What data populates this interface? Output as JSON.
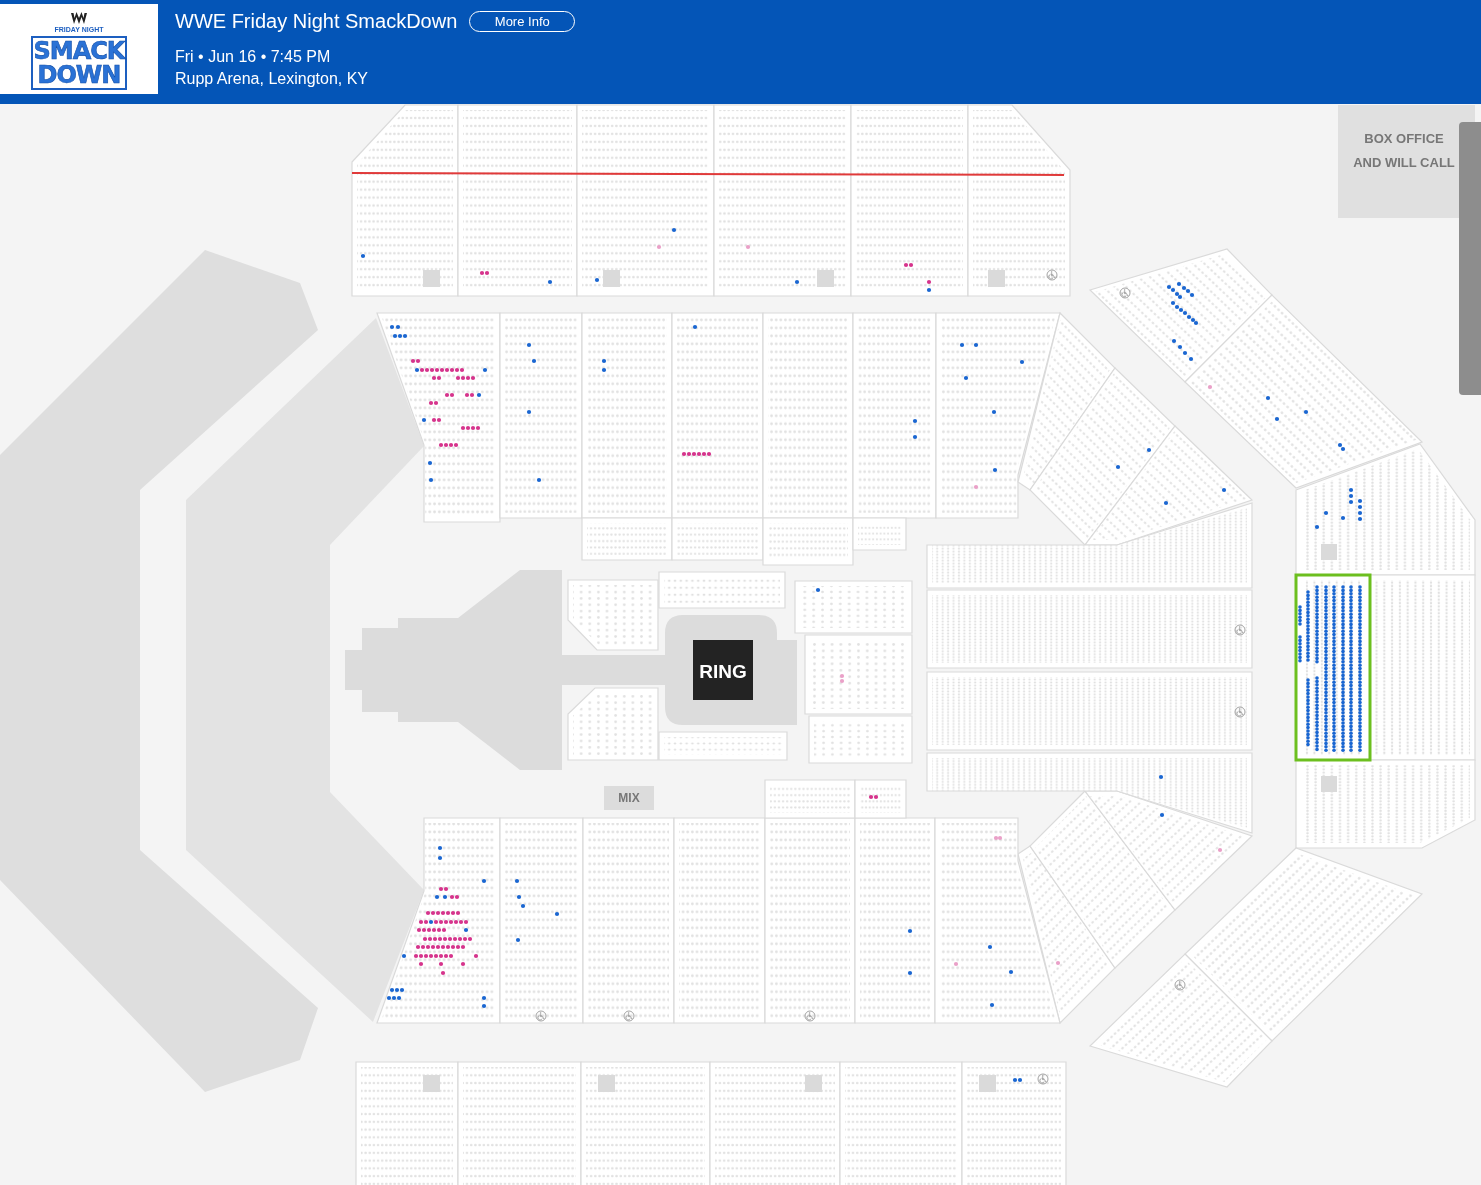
{
  "header": {
    "logo": {
      "wordmark_top": "FRIDAY NIGHT",
      "wordmark_lines": [
        "SMACK",
        "DOWN"
      ]
    },
    "event": {
      "title": "WWE Friday Night SmackDown",
      "button": "More Info",
      "date": "Fri • Jun 16 • 7:45 PM",
      "venue": "Rupp Arena, Lexington, KY"
    }
  },
  "seat_map": {
    "labels": {
      "box_office": [
        "BOX OFFICE",
        "AND WILL CALL"
      ],
      "ring": "RING",
      "mix": "MIX"
    },
    "seat_colors": [
      {
        "color": "#1a66d1"
      },
      {
        "color": "#d6338c"
      },
      {
        "color": "#eaa0c8"
      }
    ],
    "sections": [
      {
        "selected": false
      },
      {
        "selected": false
      },
      {
        "selected": false
      },
      {
        "selected": false
      },
      {
        "selected": false
      },
      {
        "selected": false
      },
      {
        "selected": false
      },
      {
        "selected": false
      },
      {
        "selected": false
      },
      {
        "selected": false
      },
      {
        "selected": false
      },
      {
        "selected": false
      },
      {
        "selected": false
      },
      {
        "selected": false
      },
      {
        "selected": false
      },
      {
        "selected": false
      },
      {
        "selected": false
      },
      {
        "selected": false
      },
      {
        "selected": false
      },
      {
        "selected": false
      },
      {
        "selected": false
      },
      {
        "selected": false
      },
      {
        "selected": false
      },
      {
        "selected": true
      },
      {
        "selected": false
      },
      {
        "selected": false
      },
      {
        "selected": false
      },
      {
        "selected": false
      },
      {
        "selected": false
      },
      {
        "selected": false
      },
      {
        "selected": false
      },
      {
        "selected": false
      },
      {
        "selected": false
      },
      {
        "selected": false
      },
      {
        "selected": false
      },
      {
        "selected": false
      },
      {
        "selected": false
      },
      {
        "selected": false
      },
      {
        "selected": false
      },
      {
        "selected": false
      },
      {
        "selected": false
      },
      {
        "selected": false
      },
      {
        "selected": false
      },
      {
        "selected": false
      },
      {
        "selected": false
      },
      {
        "selected": false
      },
      {
        "selected": false
      },
      {
        "selected": false
      },
      {
        "selected": false
      },
      {
        "selected": false
      },
      {
        "selected": false
      },
      {
        "selected": false
      },
      {
        "selected": false
      },
      {
        "selected": false
      },
      {
        "selected": false
      },
      {
        "selected": false
      },
      {
        "selected": false
      }
    ]
  }
}
